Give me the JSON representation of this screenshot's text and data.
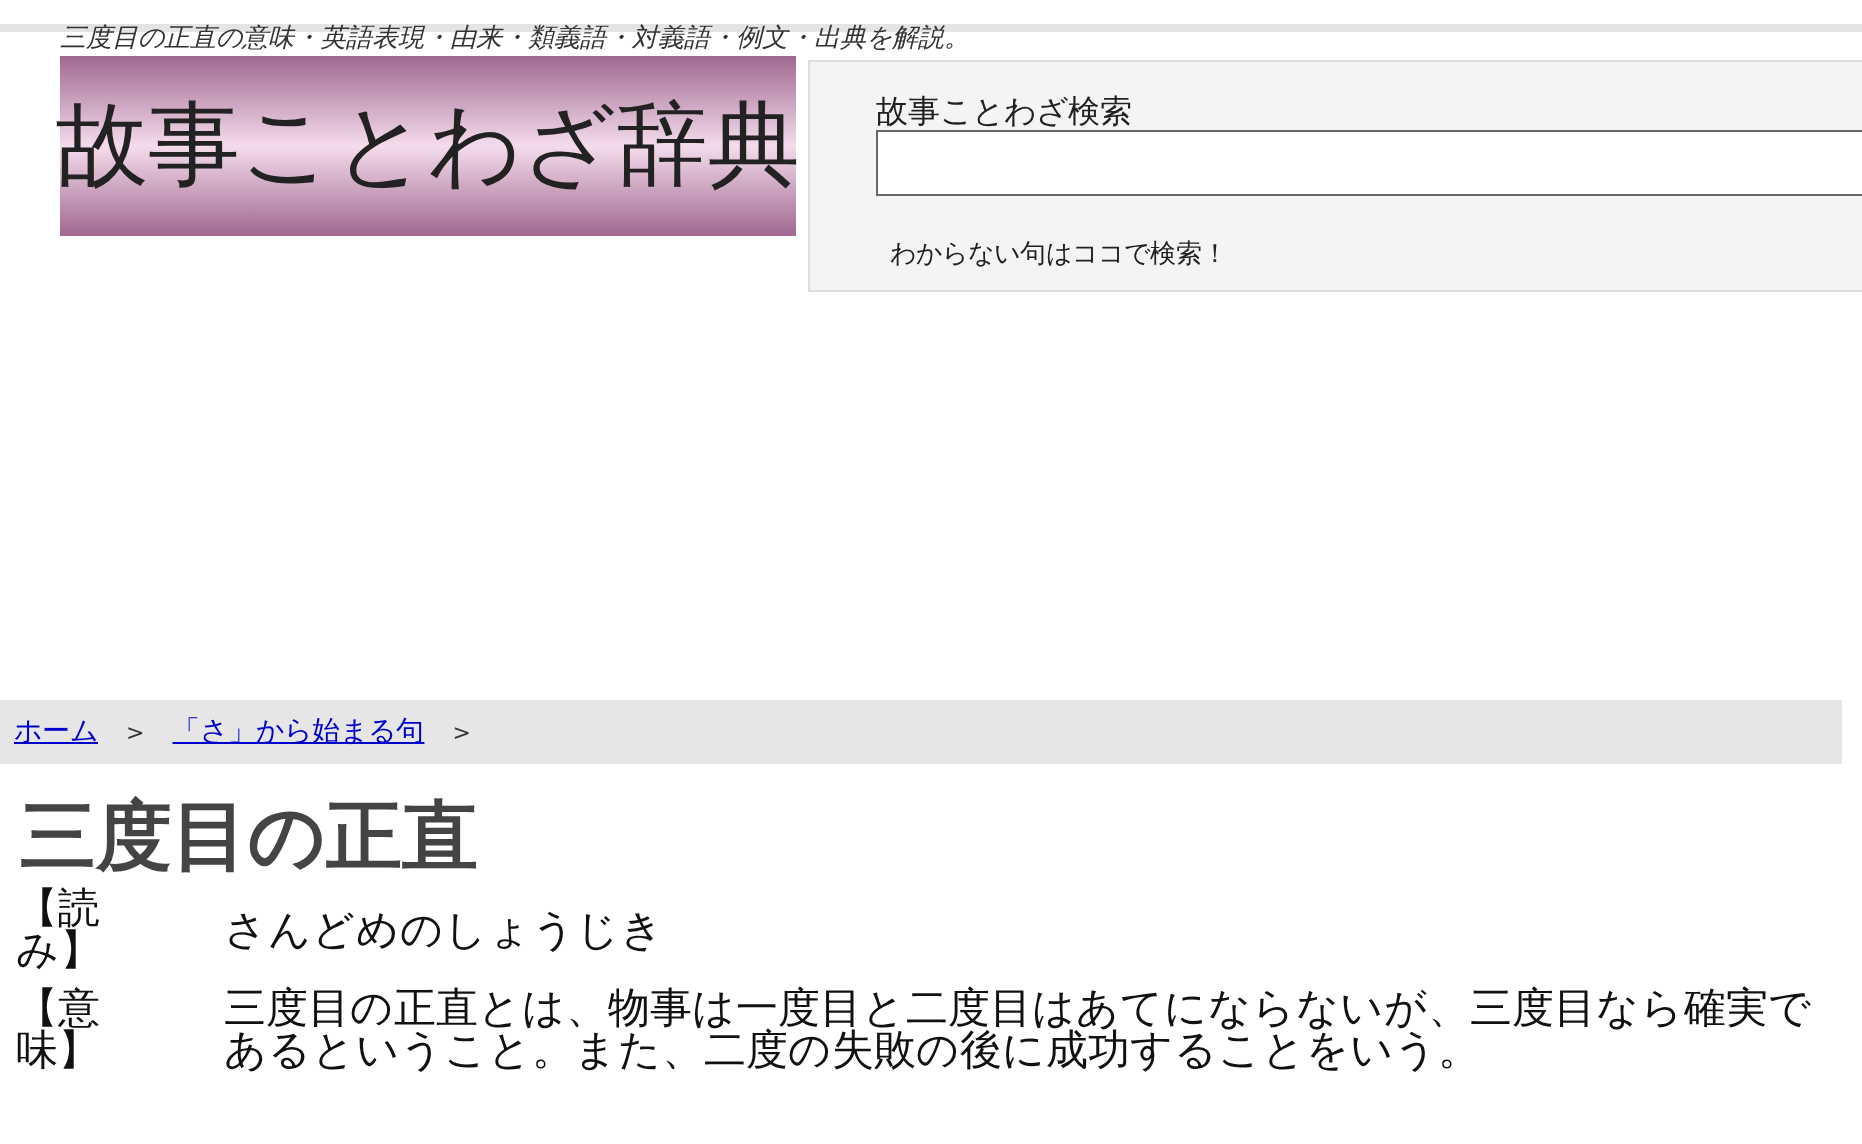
{
  "tagline": "三度目の正直の意味・英語表現・由来・類義語・対義語・例文・出典を解説。",
  "logo": "故事ことわざ辞典",
  "search": {
    "label": "故事ことわざ検索",
    "hint": "わからない句はココで検索！"
  },
  "breadcrumb": [
    {
      "text": "ホーム",
      "kind": "link"
    },
    {
      "text": ">",
      "kind": "sep"
    },
    {
      "text": "「さ」から始まる句",
      "kind": "link"
    },
    {
      "text": ">",
      "kind": "sep"
    }
  ],
  "title": "三度目の正直",
  "entries": [
    {
      "label": "【読み】",
      "text": "さんどめのしょうじき"
    },
    {
      "label": "【意味】",
      "text": "三度目の正直とは、物事は一度目と二度目はあてにならないが、三度目なら確実であるということ。また、二度の失敗の後に成功することをいう。"
    }
  ]
}
